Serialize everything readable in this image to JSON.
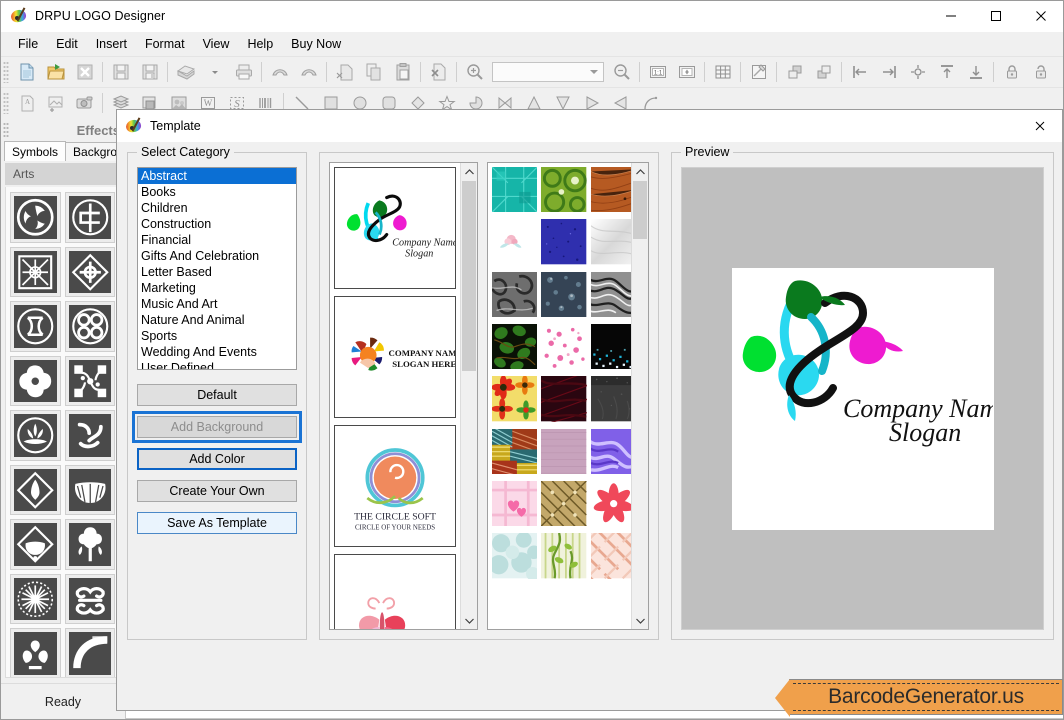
{
  "window": {
    "title": "DRPU LOGO Designer",
    "app_icon": "palette-icon",
    "minimize": "–",
    "maximize": "□",
    "close": "✕"
  },
  "menubar": {
    "items": [
      {
        "label": "File"
      },
      {
        "label": "Edit"
      },
      {
        "label": "Insert"
      },
      {
        "label": "Format"
      },
      {
        "label": "View"
      },
      {
        "label": "Help"
      },
      {
        "label": "Buy Now"
      }
    ]
  },
  "toolbar_row1": {
    "combo_value": "",
    "buttons": [
      {
        "name": "new-document-icon"
      },
      {
        "name": "open-folder-icon"
      },
      {
        "name": "close-document-icon"
      },
      {
        "name": "save-icon"
      },
      {
        "name": "save-as-icon"
      },
      {
        "name": "export-icon"
      },
      {
        "name": "print-icon"
      },
      {
        "name": "undo-icon"
      },
      {
        "name": "redo-icon"
      },
      {
        "name": "cut-icon"
      },
      {
        "name": "copy-icon"
      },
      {
        "name": "paste-icon"
      },
      {
        "name": "delete-icon"
      },
      {
        "name": "zoom-in-icon"
      },
      {
        "name": "zoom-out-icon"
      },
      {
        "name": "actual-size-icon"
      },
      {
        "name": "fit-page-icon"
      },
      {
        "name": "grid-icon"
      },
      {
        "name": "edit-canvas-icon"
      },
      {
        "name": "bring-to-front-icon"
      },
      {
        "name": "send-to-back-icon"
      },
      {
        "name": "align-left-icon"
      },
      {
        "name": "align-right-icon"
      },
      {
        "name": "align-center-icon"
      },
      {
        "name": "align-top-icon"
      },
      {
        "name": "align-bottom-icon"
      },
      {
        "name": "lock-icon"
      },
      {
        "name": "unlock-icon"
      }
    ]
  },
  "toolbar_row2": {
    "buttons": [
      {
        "name": "insert-text-icon"
      },
      {
        "name": "insert-image-icon"
      },
      {
        "name": "camera-icon"
      },
      {
        "name": "layers-icon"
      },
      {
        "name": "shapes-icon"
      },
      {
        "name": "photo-icon"
      },
      {
        "name": "watermark-icon"
      },
      {
        "name": "signature-icon"
      },
      {
        "name": "barcode-icon"
      },
      {
        "name": "line-tool-icon"
      },
      {
        "name": "rectangle-tool-icon"
      },
      {
        "name": "ellipse-tool-icon"
      },
      {
        "name": "rounded-rect-tool-icon"
      },
      {
        "name": "diamond-tool-icon"
      },
      {
        "name": "star-tool-icon"
      },
      {
        "name": "pie-tool-icon"
      },
      {
        "name": "bowtie-tool-icon"
      },
      {
        "name": "triangle-up-tool-icon"
      },
      {
        "name": "triangle-down-tool-icon"
      },
      {
        "name": "triangle-right-tool-icon"
      },
      {
        "name": "triangle-left-tool-icon"
      },
      {
        "name": "arc-tool-icon"
      }
    ]
  },
  "left_panel": {
    "header": "Effects",
    "tabs": [
      {
        "label": "Symbols",
        "active": true
      },
      {
        "label": "Background",
        "active": false
      }
    ],
    "group_label": "Arts",
    "symbols": [
      {
        "name": "triskelion-symbol"
      },
      {
        "name": "celtic-knot-circle-symbol"
      },
      {
        "name": "square-cross-weave-symbol"
      },
      {
        "name": "diamond-cross-symbol"
      },
      {
        "name": "interlocked-loops-symbol"
      },
      {
        "name": "quad-spiral-symbol"
      },
      {
        "name": "four-petal-cross-symbol"
      },
      {
        "name": "connected-squares-symbol"
      },
      {
        "name": "lotus-crest-symbol"
      },
      {
        "name": "crescent-scroll-symbol"
      },
      {
        "name": "diamond-bud-symbol"
      },
      {
        "name": "fan-leaf-symbol"
      },
      {
        "name": "diamond-fan-symbol"
      },
      {
        "name": "oak-tree-symbol"
      },
      {
        "name": "sunburst-medallion-symbol"
      },
      {
        "name": "double-scroll-symbol"
      },
      {
        "name": "heart-crest-symbol"
      },
      {
        "name": "arc-band-symbol"
      }
    ]
  },
  "statusbar": {
    "text": "Ready"
  },
  "banner": {
    "text": "BarcodeGenerator.us",
    "color": "#f0a04b"
  },
  "dialog": {
    "title": "Template",
    "icon": "palette-icon",
    "close": "✕",
    "category_group_label": "Select Category",
    "categories": [
      {
        "label": "Abstract",
        "selected": true
      },
      {
        "label": "Books",
        "selected": false
      },
      {
        "label": "Children",
        "selected": false
      },
      {
        "label": "Construction",
        "selected": false
      },
      {
        "label": "Financial",
        "selected": false
      },
      {
        "label": "Gifts And Celebration",
        "selected": false
      },
      {
        "label": "Letter Based",
        "selected": false
      },
      {
        "label": "Marketing",
        "selected": false
      },
      {
        "label": "Music And Art",
        "selected": false
      },
      {
        "label": "Nature And Animal",
        "selected": false
      },
      {
        "label": "Sports",
        "selected": false
      },
      {
        "label": "Wedding And Events",
        "selected": false
      },
      {
        "label": "User Defined",
        "selected": false
      }
    ],
    "buttons": [
      {
        "name": "default-button",
        "label": "Default",
        "state": "normal"
      },
      {
        "name": "add-background-button",
        "label": "Add Background",
        "state": "disabled-focused"
      },
      {
        "name": "add-color-button",
        "label": "Add Color",
        "state": "highlighted"
      },
      {
        "name": "create-your-own-button",
        "label": "Create Your Own",
        "state": "normal"
      },
      {
        "name": "save-as-template-button",
        "label": "Save As Template",
        "state": "light-blue"
      }
    ],
    "templates": [
      {
        "name": "leaves-swirl-logo",
        "company": "Company Name",
        "slogan": "Slogan"
      },
      {
        "name": "color-petals-logo",
        "company": "COMPANY NAME",
        "slogan": "SLOGAN HERE"
      },
      {
        "name": "circle-spiral-logo",
        "company": "The Circle Soft",
        "slogan": "CIRCLE OF YOUR NEEDS"
      },
      {
        "name": "butterfly-logo",
        "company": "",
        "slogan": ""
      }
    ],
    "backgrounds": [
      {
        "name": "teal-geometric-texture",
        "color": "#1fb6a8"
      },
      {
        "name": "green-circles-texture",
        "color": "#7aa82a"
      },
      {
        "name": "rust-scratched-texture",
        "color": "#b3521f"
      },
      {
        "name": "white-rose-texture",
        "color": "#ffffff"
      },
      {
        "name": "navy-speckle-texture",
        "color": "#2f2fa8"
      },
      {
        "name": "white-silk-texture",
        "color": "#eaeaea"
      },
      {
        "name": "gray-marble-texture",
        "color": "#6e6e6e"
      },
      {
        "name": "dark-bubble-texture",
        "color": "#4a5a6a"
      },
      {
        "name": "gray-swirl-texture",
        "color": "#8a8a8a"
      },
      {
        "name": "green-leaves-dark-texture",
        "color": "#1a2a12"
      },
      {
        "name": "pink-blossom-texture",
        "color": "#ffffff"
      },
      {
        "name": "black-city-lights-texture",
        "color": "#0a0a0a"
      },
      {
        "name": "red-flowers-texture",
        "color": "#f2d85a"
      },
      {
        "name": "dark-maroon-texture",
        "color": "#2a0a10"
      },
      {
        "name": "charcoal-texture",
        "color": "#3a3a3a"
      },
      {
        "name": "woven-stripes-texture",
        "color": "#a8471f"
      },
      {
        "name": "mauve-plain-texture",
        "color": "#c9a8c0"
      },
      {
        "name": "purple-swirl-texture",
        "color": "#8a6fe0"
      },
      {
        "name": "pink-hearts-texture",
        "color": "#fbd8e6"
      },
      {
        "name": "gold-diamond-texture",
        "color": "#c5ab6a"
      },
      {
        "name": "red-flower-white-texture",
        "color": "#ffffff"
      },
      {
        "name": "pale-blue-circles-texture",
        "color": "#d8eef0"
      },
      {
        "name": "green-vines-stripes-texture",
        "color": "#eef0d8"
      },
      {
        "name": "pink-lattice-texture",
        "color": "#f6dcd4"
      }
    ],
    "preview_group_label": "Preview",
    "preview": {
      "name": "leaves-swirl-logo-preview",
      "company": "Company Name",
      "slogan": "Slogan",
      "canvas_color": "#bfbfbf",
      "sheet_color": "#ffffff",
      "leaf_colors": [
        "#00b140",
        "#006c1e",
        "#00d9ef",
        "#ee1bd0",
        "#16b5c9"
      ]
    }
  }
}
